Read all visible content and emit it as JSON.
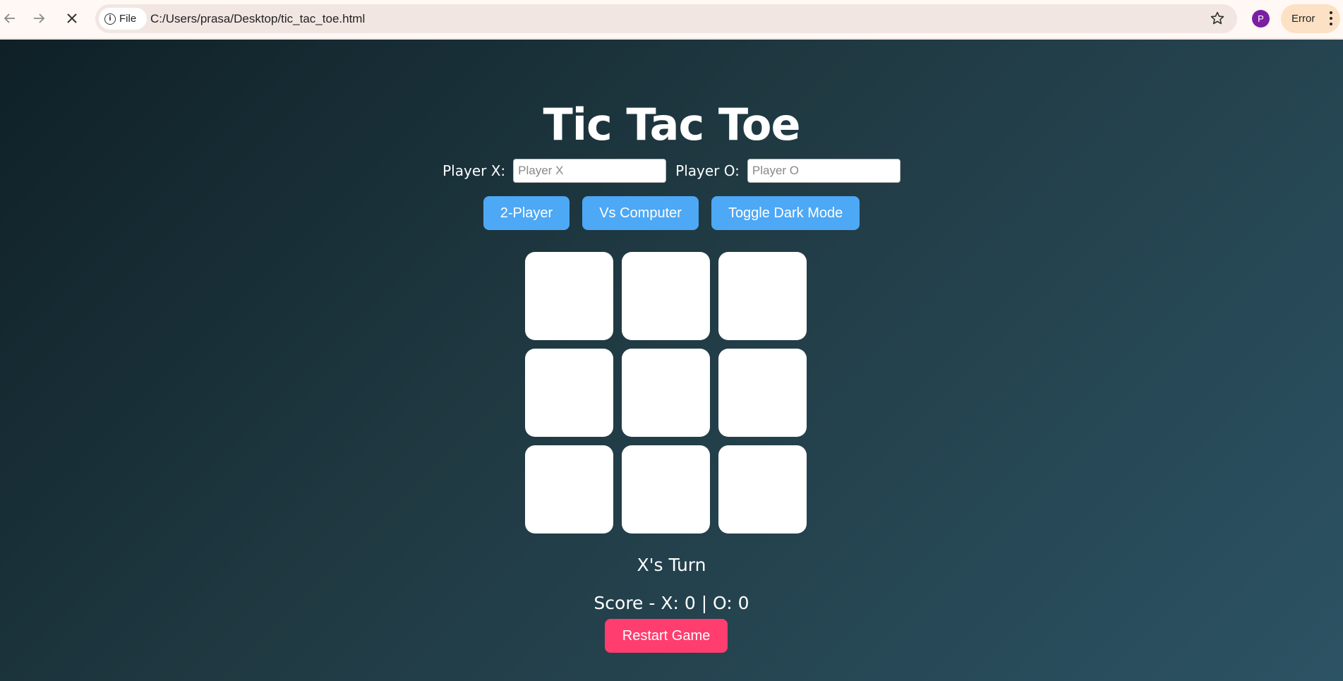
{
  "browser": {
    "site_chip_label": "File",
    "url": "C:/Users/prasa/Desktop/tic_tac_toe.html",
    "avatar_letter": "P",
    "error_label": "Error"
  },
  "game": {
    "title": "Tic Tac Toe",
    "player_x_label": "Player X:",
    "player_x_placeholder": "Player X",
    "player_o_label": "Player O:",
    "player_o_placeholder": "Player O",
    "mode_buttons": [
      "2-Player",
      "Vs Computer",
      "Toggle Dark Mode"
    ],
    "board": [
      "",
      "",
      "",
      "",
      "",
      "",
      "",
      "",
      ""
    ],
    "status": "X's Turn",
    "score": "Score - X: 0 | O: 0",
    "restart_label": "Restart Game"
  },
  "colors": {
    "accent_blue": "#4da8f5",
    "restart_pink": "#ff3d6e",
    "bg_gradient": [
      "#0f2027",
      "#203a43",
      "#2c5364"
    ]
  }
}
